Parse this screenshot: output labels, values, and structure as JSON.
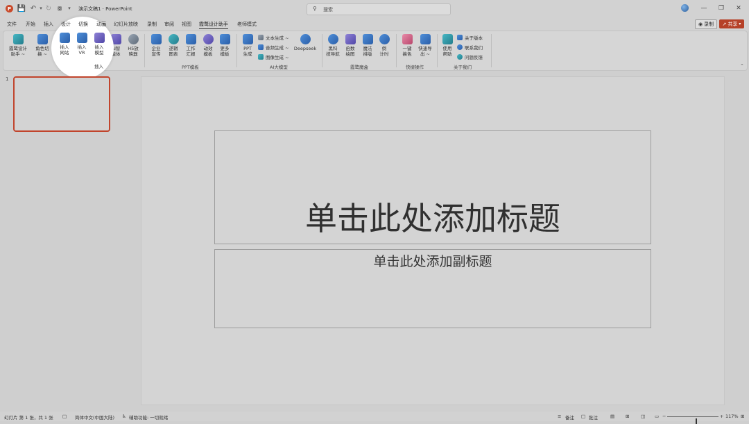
{
  "titlebar": {
    "doc_title": "演示文稿1  ·  PowerPoint",
    "search_placeholder": "搜索"
  },
  "menu": {
    "tabs": [
      "文件",
      "开始",
      "插入",
      "设计",
      "切换",
      "动画",
      "幻灯片放映",
      "录制",
      "审阅",
      "视图",
      "霞鹜设计助手",
      "老师模式"
    ],
    "active_tab": "霞鹜设计助手",
    "record_label": "录制",
    "share_label": "共享"
  },
  "ribbon": {
    "buttons": [
      {
        "label": "霞鹜设计\n助手 ~"
      },
      {
        "label": "角色切\n换 ~"
      },
      {
        "label": "插入\n网站"
      },
      {
        "label": "插入\nVR"
      },
      {
        "label": "插入\n模型"
      },
      {
        "label": "AI智\n能体"
      },
      {
        "label": "H5放\n映器"
      },
      {
        "label": "企业\n宣传"
      },
      {
        "label": "逻辑\n图表"
      },
      {
        "label": "工作\n汇报"
      },
      {
        "label": "动效\n模板"
      },
      {
        "label": "更多\n模板"
      },
      {
        "label": "PPT\n生成"
      },
      {
        "label": "Deepseek"
      },
      {
        "label": "黑科\n技导航"
      },
      {
        "label": "函数\n绘图"
      },
      {
        "label": "魔法\n排版"
      },
      {
        "label": "倒\n计时"
      },
      {
        "label": "一键\n换色"
      },
      {
        "label": "快速导\n出 ~"
      },
      {
        "label": "使用\n帮助"
      }
    ],
    "small_buttons": [
      "文本生成 ~",
      "音频生成 ~",
      "图像生成 ~",
      "关于版本",
      "联系我们",
      "问题反馈"
    ],
    "groups": [
      "插入",
      "PPT模板",
      "AI大模型",
      "霞鹜魔盒",
      "快捷操作",
      "关于我们"
    ]
  },
  "slide_pane": {
    "slide_number": "1"
  },
  "slide": {
    "title_placeholder": "单击此处添加标题",
    "subtitle_placeholder": "单击此处添加副标题"
  },
  "statusbar": {
    "slide_info": "幻灯片 第 1 张，共 1 张",
    "language": "简体中文(中国大陆)",
    "accessibility": "辅助功能: 一切就绪",
    "notes": "备注",
    "comments": "批注",
    "zoom": "117%",
    "zoom_level": 0.56
  }
}
